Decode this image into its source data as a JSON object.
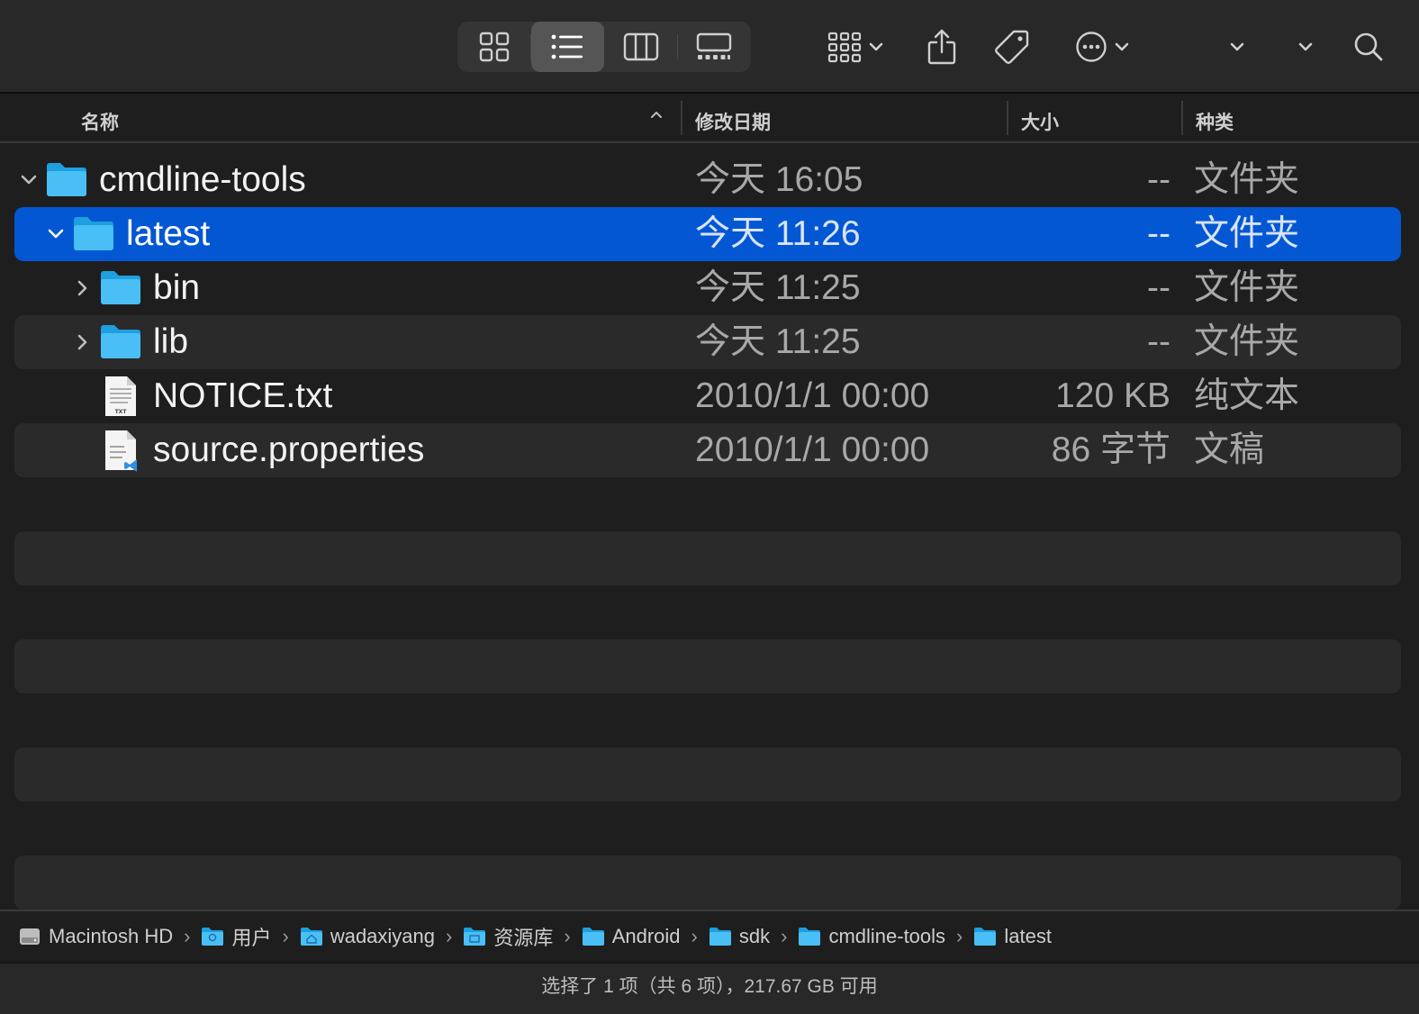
{
  "toolbar": {
    "views": [
      {
        "name": "icon-view",
        "active": false
      },
      {
        "name": "list-view",
        "active": true
      },
      {
        "name": "column-view",
        "active": false
      },
      {
        "name": "gallery-view",
        "active": false
      }
    ],
    "actions": [
      "group-icon",
      "share-icon",
      "tag-icon",
      "more-icon",
      "chevron-down-icon",
      "chevron-down-icon",
      "search-icon"
    ]
  },
  "columns": {
    "name": "名称",
    "date": "修改日期",
    "size": "大小",
    "kind": "种类"
  },
  "rows": [
    {
      "name": "cmdline-tools",
      "date": "今天 16:05",
      "size": "--",
      "kind": "文件夹",
      "icon": "folder-icon",
      "disclosure": "expanded",
      "level": 0,
      "selected": false
    },
    {
      "name": "latest",
      "date": "今天 11:26",
      "size": "--",
      "kind": "文件夹",
      "icon": "folder-icon",
      "disclosure": "expanded",
      "level": 1,
      "selected": true
    },
    {
      "name": "bin",
      "date": "今天 11:25",
      "size": "--",
      "kind": "文件夹",
      "icon": "folder-icon",
      "disclosure": "collapsed",
      "level": 2,
      "selected": false
    },
    {
      "name": "lib",
      "date": "今天 11:25",
      "size": "--",
      "kind": "文件夹",
      "icon": "folder-icon",
      "disclosure": "collapsed",
      "level": 2,
      "selected": false
    },
    {
      "name": "NOTICE.txt",
      "date": "2010/1/1 00:00",
      "size": "120 KB",
      "kind": "纯文本",
      "icon": "text-file-icon",
      "level": 2,
      "selected": false
    },
    {
      "name": "source.properties",
      "date": "2010/1/1 00:00",
      "size": "86 字节",
      "kind": "文稿",
      "icon": "document-file-icon",
      "level": 2,
      "selected": false
    }
  ],
  "pathbar": [
    {
      "label": "Macintosh HD",
      "icon": "hard-drive-icon"
    },
    {
      "label": "用户",
      "icon": "folder-icon"
    },
    {
      "label": "wadaxiyang",
      "icon": "home-folder-icon"
    },
    {
      "label": "资源库",
      "icon": "folder-icon"
    },
    {
      "label": "Android",
      "icon": "folder-icon"
    },
    {
      "label": "sdk",
      "icon": "folder-icon"
    },
    {
      "label": "cmdline-tools",
      "icon": "folder-icon"
    },
    {
      "label": "latest",
      "icon": "folder-icon"
    }
  ],
  "status": "选择了 1 项（共 6 项），217.67 GB 可用",
  "colors": {
    "selection": "#0457d3",
    "folder": "#3fb4f0"
  }
}
